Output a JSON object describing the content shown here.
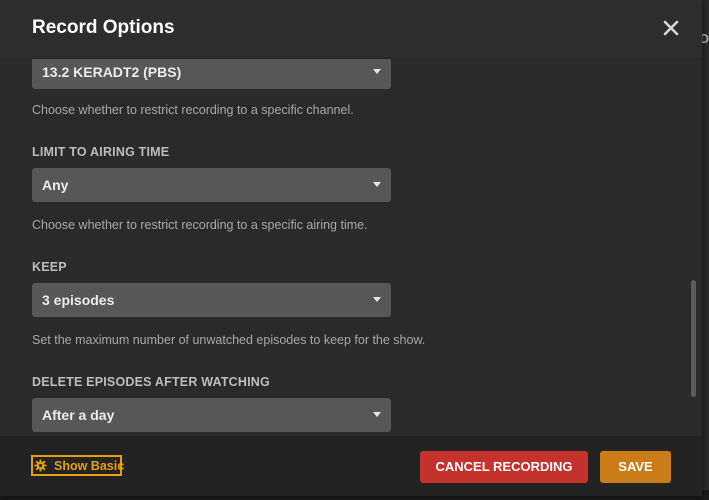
{
  "dialog": {
    "title": "Record Options",
    "close_icon": "close-icon"
  },
  "fields": {
    "channel": {
      "value": "13.2 KERADT2 (PBS)",
      "help": "Choose whether to restrict recording to a specific channel."
    },
    "airing_time": {
      "label": "LIMIT TO AIRING TIME",
      "value": "Any",
      "help": "Choose whether to restrict recording to a specific airing time."
    },
    "keep": {
      "label": "KEEP",
      "value": "3 episodes",
      "help": "Set the maximum number of unwatched episodes to keep for the show."
    },
    "delete_after": {
      "label": "DELETE EPISODES AFTER WATCHING",
      "value": "After a day"
    }
  },
  "footer": {
    "show_basic_label": "Show Basic",
    "show_basic_icon": "gear-icon",
    "cancel_label": "CANCEL RECORDING",
    "save_label": "SAVE"
  },
  "colors": {
    "accent": "#e5a00d",
    "cancel": "#c5322c",
    "save": "#cc7b19"
  }
}
